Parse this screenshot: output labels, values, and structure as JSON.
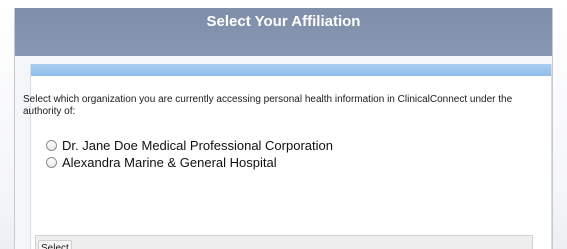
{
  "header": {
    "title": "Select Your Affiliation"
  },
  "form": {
    "instructions": "Select which organization you are currently accessing personal health information in ClinicalConnect under the authority of:",
    "options": [
      {
        "label": "Dr. Jane Doe Medical Professional Corporation",
        "selected": false
      },
      {
        "label": "Alexandra Marine & General Hospital",
        "selected": false
      }
    ],
    "select_label": "Select"
  }
}
